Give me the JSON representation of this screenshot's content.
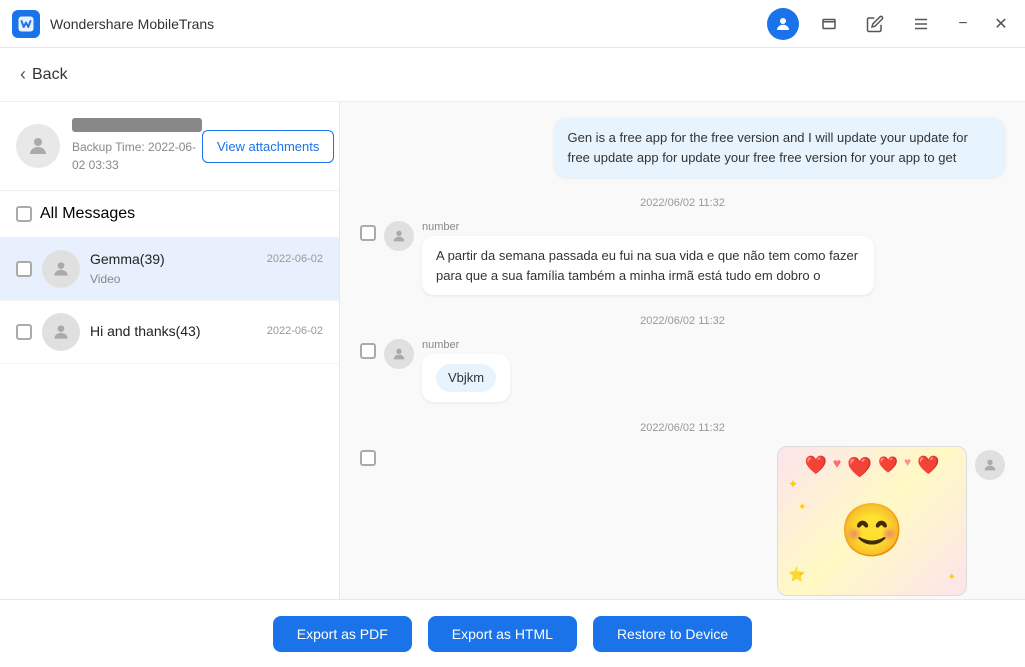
{
  "app": {
    "title": "Wondershare MobileTrans",
    "logo_text": "W"
  },
  "titlebar": {
    "controls": [
      "account",
      "window",
      "edit",
      "menu",
      "minimize",
      "close"
    ]
  },
  "back_button": {
    "label": "Back"
  },
  "contact_header": {
    "name_placeholder": "Contact Name",
    "backup_time_label": "Backup Time:",
    "backup_time_value": "2022-06-02 03:33",
    "view_attachments_label": "View attachments"
  },
  "all_messages": {
    "label": "All Messages"
  },
  "conversations": [
    {
      "name": "Gemma(39)",
      "date": "2022-06-02",
      "preview": "Video",
      "selected": true
    },
    {
      "name": "Hi and thanks(43)",
      "date": "2022-06-02",
      "preview": "",
      "selected": false
    }
  ],
  "messages": [
    {
      "type": "sent",
      "text": "Gen is a free app for the free version and I will update your update for free update app for update your free free version for your app to get",
      "show_checkbox": false,
      "show_avatar": false
    },
    {
      "type": "timestamp",
      "value": "2022/06/02 11:32"
    },
    {
      "type": "received",
      "sender": "number",
      "text": "A partir da semana passada eu fui na sua vida e que não tem como fazer para que a sua família também a minha irmã está tudo em dobro o",
      "show_checkbox": true
    },
    {
      "type": "timestamp",
      "value": "2022/06/02 11:32"
    },
    {
      "type": "received",
      "sender": "number",
      "text": "Vbjkm",
      "show_checkbox": true
    },
    {
      "type": "timestamp",
      "value": "2022/06/02 11:32"
    },
    {
      "type": "image",
      "show_checkbox": true,
      "emoji": "😊❤️"
    }
  ],
  "bottom_bar": {
    "export_pdf_label": "Export as PDF",
    "export_html_label": "Export as HTML",
    "restore_label": "Restore to Device"
  }
}
